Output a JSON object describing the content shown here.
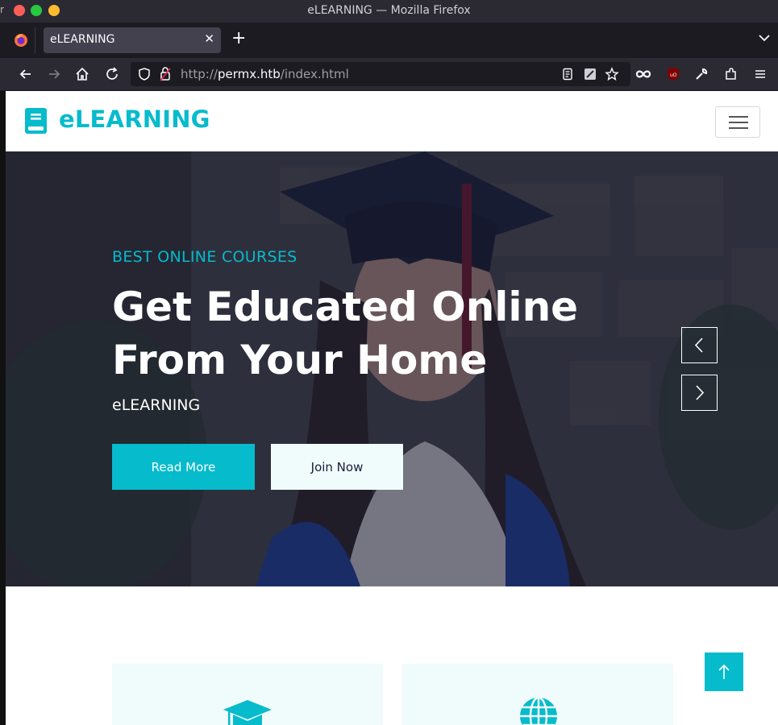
{
  "window": {
    "title": "eLEARNING — Mozilla Firefox",
    "edge_char": "r"
  },
  "tabs": [
    {
      "label": "eLEARNING",
      "active": true
    }
  ],
  "nav": {
    "url_scheme": "http://",
    "url_host": "permx.htb",
    "url_path": "/index.html"
  },
  "site": {
    "brand": "eLEARNING",
    "accent_color": "#06bbcc",
    "dark_color": "#181d38"
  },
  "hero": {
    "subtitle": "BEST ONLINE COURSES",
    "title_line1": "Get Educated Online",
    "title_line2": "From Your Home",
    "description": "eLEARNING",
    "read_more_label": "Read More",
    "join_now_label": "Join Now"
  },
  "services": {
    "cards": [
      {
        "icon": "graduation-cap-icon"
      },
      {
        "icon": "globe-icon"
      }
    ]
  }
}
